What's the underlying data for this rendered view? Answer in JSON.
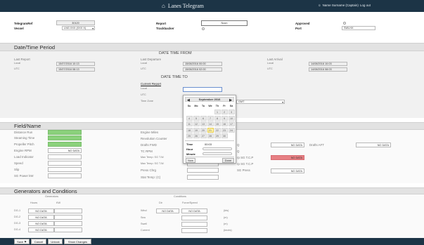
{
  "header": {
    "home_icon": "⌂",
    "app_title": "Lanes Telegram",
    "user_icon": "☺",
    "user_label": "Name Surname (Captain)",
    "logout_label": "Log out"
  },
  "top": {
    "telegram_ref_label": "TelegramRef",
    "telegram_ref_value": "30120",
    "vessel_label": "Vessel",
    "vessel_value": "LNG XXX (XXX X)",
    "report_label": "Report",
    "report_value": "Noon",
    "trackbacker_label": "Trackbacker",
    "approved_label": "Approved",
    "port_label": "Port",
    "port_value": "SWLHX"
  },
  "datetime": {
    "section_title": "Date/Time Period",
    "from_title": "DATE TIME FROM",
    "to_title": "DATE TIME TO",
    "last_report_label": "Last Report",
    "local_label": "Local",
    "utc_label": "UTC",
    "last_report_local": "15/07/2016 10:13",
    "last_report_utc": "15/07/2016 08:13",
    "last_departure_label": "Last Departure",
    "last_departure_local": "15/08/2016 00:00",
    "last_departure_utc": "15/08/2016 02:00",
    "last_arrival_label": "Last Arrival",
    "last_arrival_local": "14/08/2016 10:03",
    "last_arrival_utc": "14/08/2016 08:03",
    "current_report_label": "Current Report",
    "timezone_label": "Time Zone",
    "timezone_value": "GMT"
  },
  "datepicker": {
    "month": "September 2016",
    "prev_icon": "◀",
    "next_icon": "▶",
    "weekdays": [
      "Su",
      "Mo",
      "Tu",
      "We",
      "Th",
      "Fr",
      "Sa"
    ],
    "weeks": [
      [
        "",
        "",
        "",
        "",
        "1",
        "2",
        "3"
      ],
      [
        "4",
        "5",
        "6",
        "7",
        "8",
        "9",
        "10"
      ],
      [
        "11",
        "12",
        "13",
        "14",
        "15",
        "16",
        "17"
      ],
      [
        "18",
        "19",
        "20",
        "21",
        "22",
        "23",
        "24"
      ],
      [
        "25",
        "26",
        "27",
        "28",
        "29",
        "30",
        ""
      ]
    ],
    "time_label": "Time",
    "time_value": "00:03",
    "hour_label": "Hour",
    "minute_label": "Minute",
    "now_label": "Now",
    "done_label": "Done"
  },
  "field": {
    "section_title": "Field/Name",
    "left_labels": [
      "Distance Run",
      "Steaming Time",
      "Propeller Pitch",
      "Engine RPM",
      "Load Indicator",
      "Speed",
      "Slip",
      "SG Power kW"
    ],
    "engine_rpm_value": "NO DATA",
    "mid_labels": [
      "Engine Miles",
      "Revolution Counter",
      "Drafts FWD",
      "TC RPM",
      "Max Temp: SG T.W.",
      "Max Temp: SG T.W.",
      "Press Chrg",
      "Stat Temp: (C)"
    ],
    "right_labels": [
      "Q",
      "Q",
      "Q",
      "Q",
      "rp SG T.C.P",
      "rp SG T.C.P",
      "SG Press"
    ],
    "nodata": "NO DATA",
    "drafts_aft_label": "Drafts AFT",
    "drafts_aft_value": "NO DATA"
  },
  "generators": {
    "section_title": "Generators and Conditions",
    "generators_label": "Generators",
    "conditions_label": "Conditions",
    "hours_label": "Hours",
    "kw_label": "KW",
    "dir_label": "Dir",
    "force_label": "Force/Speed",
    "rows": [
      "DG-1",
      "DG-2",
      "DG-3",
      "DG-4"
    ],
    "nodata": "NO DATA",
    "cond_rows": [
      "Wind",
      "Sea",
      "Swell",
      "Current"
    ],
    "units": [
      "(kts)",
      "(m)",
      "(m)",
      "(knots)"
    ]
  },
  "bottom": {
    "save_label": "Save",
    "save_icon": "⚑",
    "cancel_label": "Cancel",
    "unlock_label": "Unlock",
    "show_changes_label": "Show Changes"
  }
}
